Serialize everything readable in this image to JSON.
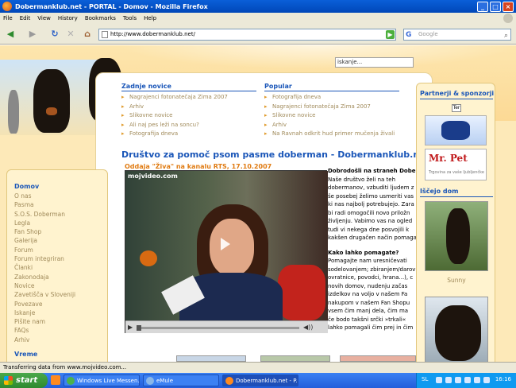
{
  "window": {
    "title": "Dobermanklub.net - PORTAL - Domov - Mozilla Firefox"
  },
  "menubar": [
    "File",
    "Edit",
    "View",
    "History",
    "Bookmarks",
    "Tools",
    "Help"
  ],
  "toolbar": {
    "url": "http://www.dobermanklub.net/",
    "search_placeholder": "Google"
  },
  "site": {
    "search_value": "iskanje...",
    "latest_news": {
      "heading": "Zadnje novice",
      "items": [
        "Nagrajenci fotonatečaja Zima 2007",
        "Arhiv",
        "Slikovne novice",
        "Ali naj pes leži na soncu?",
        "Fotografija dneva"
      ]
    },
    "popular": {
      "heading": "Popular",
      "items": [
        "Fotografija dneva",
        "Nagrajenci fotonatečaja Zima 2007",
        "Slikovne novice",
        "Arhiv",
        "Na Ravnah odkrit hud primer mučenja živali"
      ]
    },
    "main_title": "Društvo za pomoč psom pasme doberman - Dobermanklub.net",
    "video_title": "Oddaja \"Živa\" na kanalu RTS, 17.10.2007",
    "video_watermark": "mojvideo.com",
    "welcome": {
      "heading": "Dobrodošli na straneh Dobe",
      "paragraph1": [
        "Naše društvo želi na teh",
        "dobermanov, vzbuditi ljudem z",
        "še posebej želimo usmeriti vas",
        "ki nas najbolj potrebujejo. Zara",
        "bi radi omogočili novo priložn",
        "življenju. Vabimo vas na ogled",
        "tudi vi nekega dne posvojili k",
        "kakšen drugačen način pomaga"
      ],
      "heading2": "Kako lahko pomagate?",
      "paragraph2": [
        "Pomagajte nam uresničevati",
        "sodelovanjem; zbiranjem/darov",
        "ovratnice, povodci, hrana...), c",
        "novih domov, nudenju začas",
        "izdelkov na voljo v našem Fa",
        "nakupom v našem Fan Shopu",
        "vsem čim manj dela, čim ma",
        "če bodo takšni srčki »trkali«",
        "lahko pomagali čim prej in čim"
      ]
    },
    "left_menu": {
      "items": [
        "Domov",
        "O nas",
        "Pasma",
        "S.O.S. Doberman",
        "Legla",
        "Fan Shop",
        "Galerija",
        "Forum",
        "Forum integriran",
        "Članki",
        "Zakonodaja",
        "Novice",
        "Zavetišča v Sloveniji",
        "Povezave",
        "Iskanje",
        "Pišite nam",
        "FAQs",
        "Arhiv"
      ],
      "vreme": "Vreme"
    },
    "right": {
      "partners_title": "Partnerji & sponzorji",
      "banner_small_text": "Ter",
      "mrpet_logo": "Mr. Pet",
      "mrpet_tagline": "Trgovina za vaše ljubljenčke",
      "home_title": "Iščejo dom",
      "dog_name": "Sunny"
    }
  },
  "statusbar": "Transferring data from www.mojvideo.com...",
  "taskbar": {
    "start": "start",
    "tasks": [
      {
        "label": "Windows Live Messen...",
        "active": false
      },
      {
        "label": "eMule",
        "active": false
      },
      {
        "label": "Dobermanklub.net - P...",
        "active": true
      }
    ],
    "tray_lang": "SL",
    "clock": "16:16"
  }
}
